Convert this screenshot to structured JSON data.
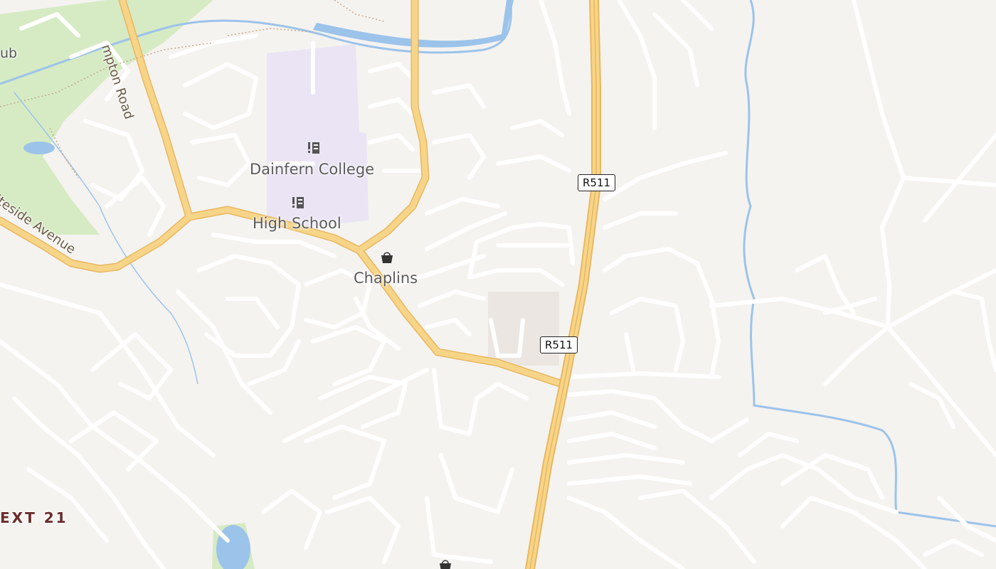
{
  "map": {
    "colors": {
      "background": "#f5f3f0",
      "water": "#9cc3ea",
      "park": "#d6ebc4",
      "school": "#ebe4f5",
      "highway": "#f7d588",
      "highway_edge": "#e8b760",
      "street": "#ffffff",
      "commercial": "#ebe6e1"
    },
    "labels": {
      "dainfern_college": "Dainfern College",
      "high_school": "High School",
      "chaplins": "Chaplins",
      "hampton_road": "mpton Road",
      "riverside_avenue": "iteside Avenue",
      "ext21": "EXT 21",
      "club": "ub"
    },
    "shields": {
      "r511_a": "R511",
      "r511_b": "R511"
    },
    "icons": {
      "school_icon": "school-icon",
      "shop_icon": "shopping-bag-icon"
    }
  }
}
